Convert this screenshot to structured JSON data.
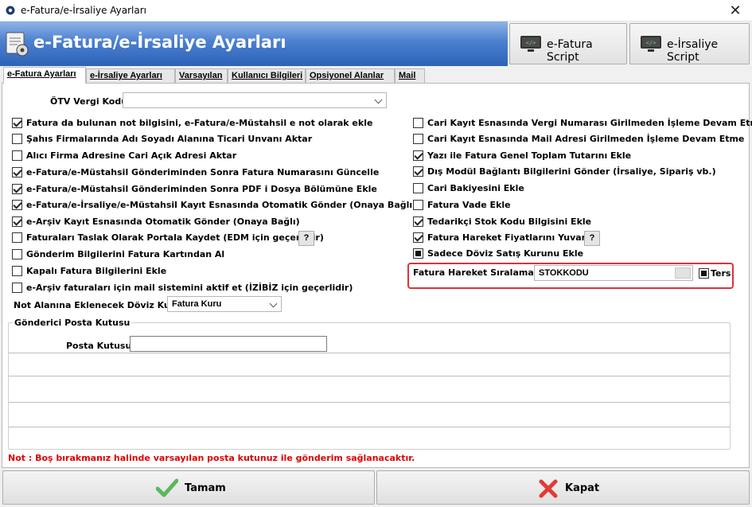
{
  "window": {
    "title": "e-Fatura/e-İrsaliye Ayarları",
    "close_icon": "close-icon"
  },
  "header": {
    "title": "e-Fatura/e-İrsaliye Ayarları",
    "efatura_script_label": "e-Fatura Script",
    "eirsaliye_script_label": "e-İrsaliye Script"
  },
  "tabs": [
    {
      "label": "e-Fatura Ayarları",
      "active": true
    },
    {
      "label": "e-İrsaliye Ayarları",
      "active": false
    },
    {
      "label": "Varsayılan",
      "active": false
    },
    {
      "label": "Kullanıcı Bilgileri",
      "active": false
    },
    {
      "label": "Opsiyonel Alanlar",
      "active": false
    },
    {
      "label": "Mail",
      "active": false
    }
  ],
  "otv": {
    "label": "ÖTV Vergi Kodu",
    "value": ""
  },
  "left_options": [
    {
      "label": "Fatura da bulunan not bilgisini, e-Fatura/e-Müstahsil e not olarak ekle",
      "checked": true
    },
    {
      "label": "Şahıs Firmalarında Adı Soyadı Alanına Ticari Unvanı Aktar",
      "checked": false
    },
    {
      "label": "Alıcı Firma Adresine Cari Açık Adresi Aktar",
      "checked": false
    },
    {
      "label": "e-Fatura/e-Müstahsil Gönderiminden Sonra Fatura Numarasını Güncelle",
      "checked": true
    },
    {
      "label": "e-Fatura/e-Müstahsil Gönderiminden Sonra PDF i Dosya Bölümüne Ekle",
      "checked": true
    },
    {
      "label": "e-Fatura/e-İrsaliye/e-Müstahsil Kayıt Esnasında Otomatik Gönder (Onaya Bağlı)",
      "checked": true
    },
    {
      "label": "e-Arşiv Kayıt Esnasında Otomatik Gönder (Onaya Bağlı)",
      "checked": true
    },
    {
      "label": "Faturaları Taslak Olarak Portala Kaydet (EDM için geçerlidir)",
      "checked": false,
      "help": "?"
    },
    {
      "label": "Gönderim Bilgilerini Fatura Kartından Al",
      "checked": false
    },
    {
      "label": "Kapalı Fatura Bilgilerini Ekle",
      "checked": false
    },
    {
      "label": "e-Arşiv faturaları için mail sistemini aktif et (İZİBİZ için geçerlidir)",
      "checked": false
    }
  ],
  "right_options": [
    {
      "label": "Cari Kayıt Esnasında Vergi Numarası Girilmeden İşleme Devam Etme",
      "state": "unchecked"
    },
    {
      "label": "Cari Kayıt Esnasında Mail Adresi Girilmeden İşleme Devam Etme",
      "state": "unchecked"
    },
    {
      "label": "Yazı ile Fatura Genel Toplam Tutarını Ekle",
      "state": "checked"
    },
    {
      "label": "Dış Modül Bağlantı Bilgilerini Gönder (İrsaliye, Sipariş vb.)",
      "state": "checked"
    },
    {
      "label": "Cari Bakiyesini Ekle",
      "state": "unchecked"
    },
    {
      "label": "Fatura Vade Ekle",
      "state": "unchecked"
    },
    {
      "label": "Tedarikçi Stok Kodu Bilgisini Ekle",
      "state": "checked"
    },
    {
      "label": "Fatura Hareket Fiyatlarını Yuvarla",
      "state": "checked",
      "help": "?"
    },
    {
      "label": "Sadece Döviz Satış Kurunu Ekle",
      "state": "filled"
    }
  ],
  "sort": {
    "label": "Fatura Hareket Sıralaması",
    "value": "STOKKODU",
    "reverse_label": "Ters"
  },
  "currency": {
    "label": "Not Alanına Eklenecek Döviz Kuru",
    "value": "Fatura Kuru"
  },
  "mailbox": {
    "group_title": "Gönderici Posta Kutusu",
    "label": "Posta Kutusu",
    "value": ""
  },
  "note": "Not : Boş bırakmanız halinde varsayılan posta kutunuz ile gönderim sağlanacaktır.",
  "footer": {
    "ok_label": "Tamam",
    "close_label": "Kapat"
  },
  "colors": {
    "banner": "#2d63b7",
    "note": "#e00000",
    "highlight": "#d9353a",
    "ok_icon": "#4caf50",
    "close_icon": "#e53935"
  }
}
